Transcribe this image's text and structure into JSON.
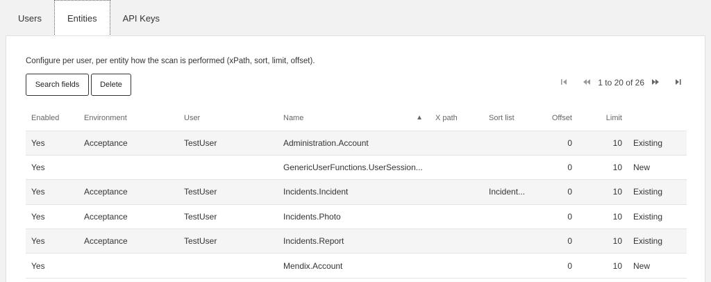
{
  "tabs": [
    {
      "label": "Users"
    },
    {
      "label": "Entities"
    },
    {
      "label": "API Keys"
    }
  ],
  "description": "Configure per user, per entity how the scan is performed (xPath, sort, limit, offset).",
  "toolbar": {
    "search_fields_label": "Search fields",
    "delete_label": "Delete"
  },
  "pager": {
    "text": "1 to 20 of 26",
    "first_icon": "first-page-icon",
    "prev_icon": "previous-page-icon",
    "next_icon": "next-page-icon",
    "last_icon": "last-page-icon"
  },
  "table": {
    "headers": {
      "enabled": "Enabled",
      "environment": "Environment",
      "user": "User",
      "name": "Name",
      "sort_indicator": "▲",
      "xpath": "X path",
      "sort_list": "Sort list",
      "offset": "Offset",
      "limit": "Limit",
      "status": ""
    },
    "rows": [
      {
        "enabled": "Yes",
        "environment": "Acceptance",
        "user": "TestUser",
        "name": "Administration.Account",
        "xpath": "",
        "sort_list": "",
        "offset": "0",
        "limit": "10",
        "status": "Existing"
      },
      {
        "enabled": "Yes",
        "environment": "",
        "user": "",
        "name": "GenericUserFunctions.UserSession...",
        "xpath": "",
        "sort_list": "",
        "offset": "0",
        "limit": "10",
        "status": "New"
      },
      {
        "enabled": "Yes",
        "environment": "Acceptance",
        "user": "TestUser",
        "name": "Incidents.Incident",
        "xpath": "",
        "sort_list": "Incident...",
        "offset": "0",
        "limit": "10",
        "status": "Existing"
      },
      {
        "enabled": "Yes",
        "environment": "Acceptance",
        "user": "TestUser",
        "name": "Incidents.Photo",
        "xpath": "",
        "sort_list": "",
        "offset": "0",
        "limit": "10",
        "status": "Existing"
      },
      {
        "enabled": "Yes",
        "environment": "Acceptance",
        "user": "TestUser",
        "name": "Incidents.Report",
        "xpath": "",
        "sort_list": "",
        "offset": "0",
        "limit": "10",
        "status": "Existing"
      },
      {
        "enabled": "Yes",
        "environment": "",
        "user": "",
        "name": "Mendix.Account",
        "xpath": "",
        "sort_list": "",
        "offset": "0",
        "limit": "10",
        "status": "New"
      }
    ]
  }
}
